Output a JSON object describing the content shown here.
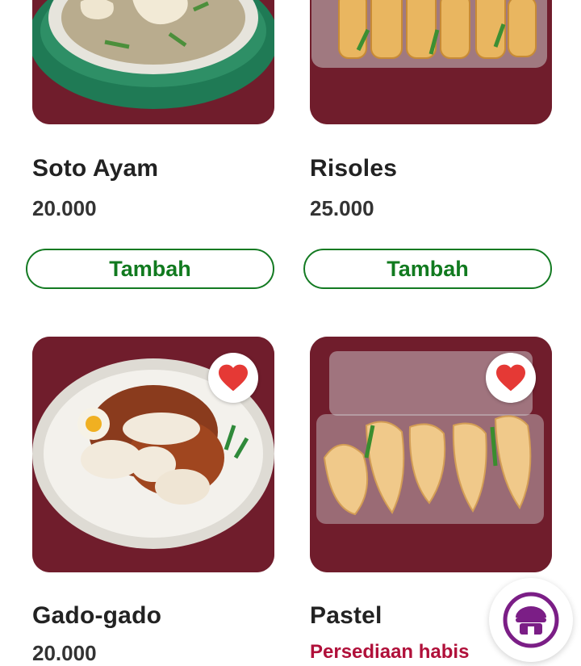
{
  "products": [
    {
      "name": "Soto Ayam",
      "price": "20.000",
      "button": "Tambah",
      "favorite": false,
      "image": "soto-ayam-bowl"
    },
    {
      "name": "Risoles",
      "price": "25.000",
      "button": "Tambah",
      "favorite": false,
      "image": "risoles-tray"
    },
    {
      "name": "Gado-gado",
      "price": "20.000",
      "favorite": true,
      "image": "gado-gado-plate"
    },
    {
      "name": "Pastel",
      "stock_status": "Persediaan habis",
      "favorite": true,
      "image": "pastel-tray"
    }
  ],
  "icons": {
    "favorite": "heart-icon",
    "store": "store-icon"
  },
  "colors": {
    "accent": "#117a1f",
    "favorite": "#e53935",
    "stock_out": "#b0103a",
    "store": "#7b1e86",
    "photo_bg": "#701d2c"
  }
}
